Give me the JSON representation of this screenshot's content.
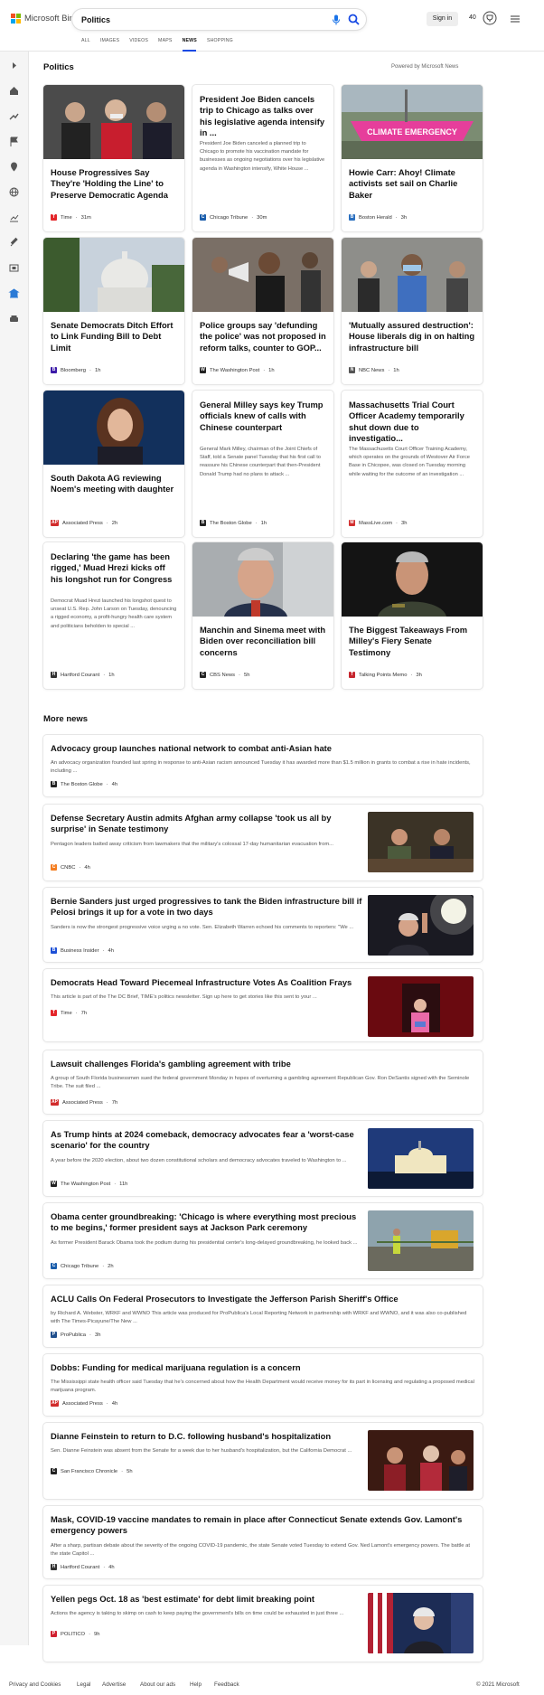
{
  "header": {
    "brand": "Microsoft Bing",
    "search_value": "Politics",
    "sign_in": "Sign in",
    "points": "40",
    "tabs": [
      "ALL",
      "IMAGES",
      "VIDEOS",
      "MAPS",
      "NEWS",
      "SHOPPING"
    ],
    "active_tab": "NEWS"
  },
  "section": {
    "title": "Politics",
    "powered": "Powered by Microsoft News"
  },
  "cards": [
    {
      "title": "House Progressives Say They're 'Holding the Line' to Preserve Democratic Agenda",
      "abstract": "",
      "source": "Time",
      "age": "31m",
      "fav_color": "#e4262a",
      "fav_letter": "T"
    },
    {
      "title": "President Joe Biden cancels trip to Chicago as talks over his legislative agenda intensify in ...",
      "abstract": "President Joe Biden canceled a planned trip to Chicago to promote his vaccination mandate for businesses as ongoing negotiations over his legislative agenda in Washington intensify, White House ...",
      "source": "Chicago Tribune",
      "age": "30m",
      "fav_color": "#1a5dab",
      "fav_letter": "C"
    },
    {
      "title": "Howie Carr: Ahoy! Climate activists set sail on Charlie Baker",
      "abstract": "",
      "source": "Boston Herald",
      "age": "3h",
      "fav_color": "#2a6fbf",
      "fav_letter": "B"
    },
    {
      "title": "Senate Democrats Ditch Effort to Link Funding Bill to Debt Limit",
      "abstract": "",
      "source": "Bloomberg",
      "age": "1h",
      "fav_color": "#3b1aa8",
      "fav_letter": "B"
    },
    {
      "title": "Police groups say 'defunding the police' was not proposed in reform talks, counter to GOP...",
      "abstract": "",
      "source": "The Washington Post",
      "age": "1h",
      "fav_color": "#222",
      "fav_letter": "W"
    },
    {
      "title": "'Mutually assured destruction': House liberals dig in on halting infrastructure bill",
      "abstract": "",
      "source": "NBC News",
      "age": "1h",
      "fav_color": "#555",
      "fav_letter": "N"
    },
    {
      "title": "South Dakota AG reviewing Noem's meeting with daughter",
      "abstract": "",
      "source": "Associated Press",
      "age": "2h",
      "fav_color": "#d12b2b",
      "fav_letter": "AP"
    },
    {
      "title": "General Milley says key Trump officials knew of calls with Chinese counterpart",
      "abstract": "General Mark Milley, chairman of the Joint Chiefs of Staff, told a Senate panel Tuesday that his first call to reassure his Chinese counterpart that then-President Donald Trump had no plans to attack ...",
      "source": "The Boston Globe",
      "age": "1h",
      "fav_color": "#222",
      "fav_letter": "B"
    },
    {
      "title": "Massachusetts Trial Court Officer Academy temporarily shut down due to investigatio...",
      "abstract": "The Massachusetts Court Officer Training Academy, which operates on the grounds of Westover Air Force Base in Chicopee, was closed on Tuesday morning while waiting for the outcome of an investigation ...",
      "source": "MassLive.com",
      "age": "3h",
      "fav_color": "#d22f2f",
      "fav_letter": "M"
    },
    {
      "title": "Declaring 'the game has been rigged,' Muad Hrezi kicks off his longshot run for Congress",
      "abstract": "Democrat Muad Hrezi launched his longshot quest to unseat U.S. Rep. John Larson on Tuesday, denouncing a rigged economy, a profit-hungry health care system and politicians beholden to special ...",
      "source": "Hartford Courant",
      "age": "1h",
      "fav_color": "#333",
      "fav_letter": "H"
    },
    {
      "title": "Manchin and Sinema meet with Biden over reconciliation bill concerns",
      "abstract": "",
      "source": "CBS News",
      "age": "5h",
      "fav_color": "#222",
      "fav_letter": "C"
    },
    {
      "title": "The Biggest Takeaways From Milley's Fiery Senate Testimony",
      "abstract": "",
      "source": "Talking Points Memo",
      "age": "3h",
      "fav_color": "#c6262e",
      "fav_letter": "T"
    }
  ],
  "more_title": "More news",
  "articles": [
    {
      "title": "Advocacy group launches national network to combat anti-Asian hate",
      "abstract": "An advocacy organization founded last spring in response to anti-Asian racism announced Tuesday it has awarded more than $1.5 million in grants to combat a rise in hate incidents, including ...",
      "source": "The Boston Globe",
      "age": "4h",
      "fav_color": "#222",
      "fav_letter": "B",
      "thumb": false
    },
    {
      "title": "Defense Secretary Austin admits Afghan army collapse 'took us all by surprise' in Senate testimony",
      "abstract": "Pentagon leaders batted away criticism from lawmakers that the military's colossal 17-day humanitarian evacuation from...",
      "source": "CNBC",
      "age": "4h",
      "fav_color": "#f47d20",
      "fav_letter": "C",
      "thumb": true
    },
    {
      "title": "Bernie Sanders just urged progressives to tank the Biden infrastructure bill if Pelosi brings it up for a vote in two days",
      "abstract": "Sanders is now the strongest progressive voice urging a no vote. Sen. Elizabeth Warren echoed his comments to reporters: \"We ...",
      "source": "Business Insider",
      "age": "4h",
      "fav_color": "#1c4fd6",
      "fav_letter": "B",
      "thumb": true
    },
    {
      "title": "Democrats Head Toward Piecemeal Infrastructure Votes As Coalition Frays",
      "abstract": "This article is part of the The DC Brief, TIME's politics newsletter. Sign up here to get stories like this sent to your ...",
      "source": "Time",
      "age": "7h",
      "fav_color": "#e4262a",
      "fav_letter": "T",
      "thumb": true
    },
    {
      "title": "Lawsuit challenges Florida's gambling agreement with tribe",
      "abstract": "A group of South Florida businessmen sued the federal government Monday in hopes of overturning a gambling agreement Republican Gov. Ron DeSantis signed with the Seminole Tribe. The suit filed ...",
      "source": "Associated Press",
      "age": "7h",
      "fav_color": "#d12b2b",
      "fav_letter": "AP",
      "thumb": false
    },
    {
      "title": "As Trump hints at 2024 comeback, democracy advocates fear a 'worst-case scenario' for the country",
      "abstract": "A year before the 2020 election, about two dozen constitutional scholars and democracy advocates traveled to Washington to ...",
      "source": "The Washington Post",
      "age": "11h",
      "fav_color": "#222",
      "fav_letter": "W",
      "thumb": true
    },
    {
      "title": "Obama center groundbreaking: 'Chicago is where everything most precious to me begins,' former president says at Jackson Park ceremony",
      "abstract": "As former President Barack Obama took the podium during his presidential center's long-delayed groundbreaking, he looked back ...",
      "source": "Chicago Tribune",
      "age": "2h",
      "fav_color": "#1a5dab",
      "fav_letter": "C",
      "thumb": true
    },
    {
      "title": "ACLU Calls On Federal Prosecutors to Investigate the Jefferson Parish Sheriff's Office",
      "abstract": "by Richard A. Webster, WRKF and WWNO This article was produced for ProPublica's Local Reporting Network in partnership with WRKF and WWNO, and it was also co-published with The Times-Picayune/The New ...",
      "source": "ProPublica",
      "age": "3h",
      "fav_color": "#1f4e8c",
      "fav_letter": "P",
      "thumb": false
    },
    {
      "title": "Dobbs: Funding for medical marijuana regulation is a concern",
      "abstract": "The Mississippi state health officer said Tuesday that he's concerned about how the Health Department would receive money for its part in licensing and regulating a proposed medical marijuana program.",
      "source": "Associated Press",
      "age": "4h",
      "fav_color": "#d12b2b",
      "fav_letter": "AP",
      "thumb": false
    },
    {
      "title": "Dianne Feinstein to return to D.C. following husband's hospitalization",
      "abstract": "Sen. Dianne Feinstein was absent from the Senate for a week due to her husband's hospitalization, but the California Democrat ...",
      "source": "San Francisco Chronicle",
      "age": "5h",
      "fav_color": "#222",
      "fav_letter": "C",
      "thumb": true
    },
    {
      "title": "Mask, COVID-19 vaccine mandates to remain in place after Connecticut Senate extends Gov. Lamont's emergency powers",
      "abstract": "After a sharp, partisan debate about the severity of the ongoing COVID-19 pandemic, the state Senate voted Tuesday to extend Gov. Ned Lamont's emergency powers. The battle at the state Capitol ...",
      "source": "Hartford Courant",
      "age": "4h",
      "fav_color": "#333",
      "fav_letter": "H",
      "thumb": false
    },
    {
      "title": "Yellen pegs Oct. 18 as 'best estimate' for debt limit breaking point",
      "abstract": "Actions the agency is taking to skimp on cash to keep paying the government's bills on time could be exhausted in just three ...",
      "source": "POLITICO",
      "age": "9h",
      "fav_color": "#d0202f",
      "fav_letter": "P",
      "thumb": true
    }
  ],
  "footer": {
    "links": [
      "Privacy and Cookies",
      "Legal",
      "Advertise",
      "About our ads",
      "Help",
      "Feedback"
    ],
    "copyright": "© 2021 Microsoft"
  }
}
